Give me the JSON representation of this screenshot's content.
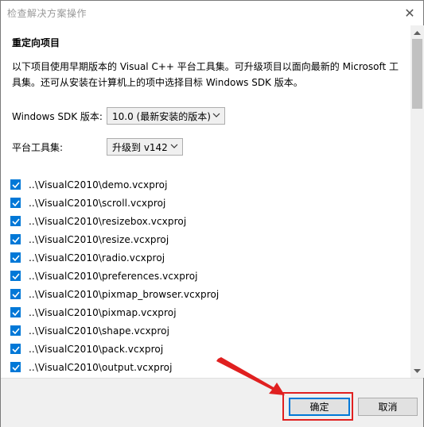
{
  "window": {
    "title": "检查解决方案操作",
    "close_glyph": "✕"
  },
  "main": {
    "section_title": "重定向项目",
    "description": "以下项目使用早期版本的 Visual C++ 平台工具集。可升级项目以面向最新的 Microsoft 工具集。还可从安装在计算机上的项中选择目标 Windows SDK 版本。",
    "sdk": {
      "label": "Windows SDK 版本:",
      "value": "10.0 (最新安装的版本)"
    },
    "toolset": {
      "label": "平台工具集:",
      "value": "升级到 v142"
    },
    "projects": [
      {
        "path": "..\\VisualC2010\\demo.vcxproj",
        "checked": true
      },
      {
        "path": "..\\VisualC2010\\scroll.vcxproj",
        "checked": true
      },
      {
        "path": "..\\VisualC2010\\resizebox.vcxproj",
        "checked": true
      },
      {
        "path": "..\\VisualC2010\\resize.vcxproj",
        "checked": true
      },
      {
        "path": "..\\VisualC2010\\radio.vcxproj",
        "checked": true
      },
      {
        "path": "..\\VisualC2010\\preferences.vcxproj",
        "checked": true
      },
      {
        "path": "..\\VisualC2010\\pixmap_browser.vcxproj",
        "checked": true
      },
      {
        "path": "..\\VisualC2010\\pixmap.vcxproj",
        "checked": true
      },
      {
        "path": "..\\VisualC2010\\shape.vcxproj",
        "checked": true
      },
      {
        "path": "..\\VisualC2010\\pack.vcxproj",
        "checked": true
      },
      {
        "path": "..\\VisualC2010\\output.vcxproj",
        "checked": true
      }
    ]
  },
  "footer": {
    "ok_label": "确定",
    "cancel_label": "取消"
  },
  "colors": {
    "checkbox_fill": "#0078d7",
    "annotation_red": "#e02020",
    "footer_bg": "#f0f0f0"
  },
  "icons": {
    "close": "close-icon",
    "dropdown": "chevron-down-icon",
    "check": "check-icon",
    "scroll_up": "scroll-up-arrow-icon",
    "scroll_down": "scroll-down-arrow-icon",
    "annotation": "red-arrow-annotation"
  }
}
